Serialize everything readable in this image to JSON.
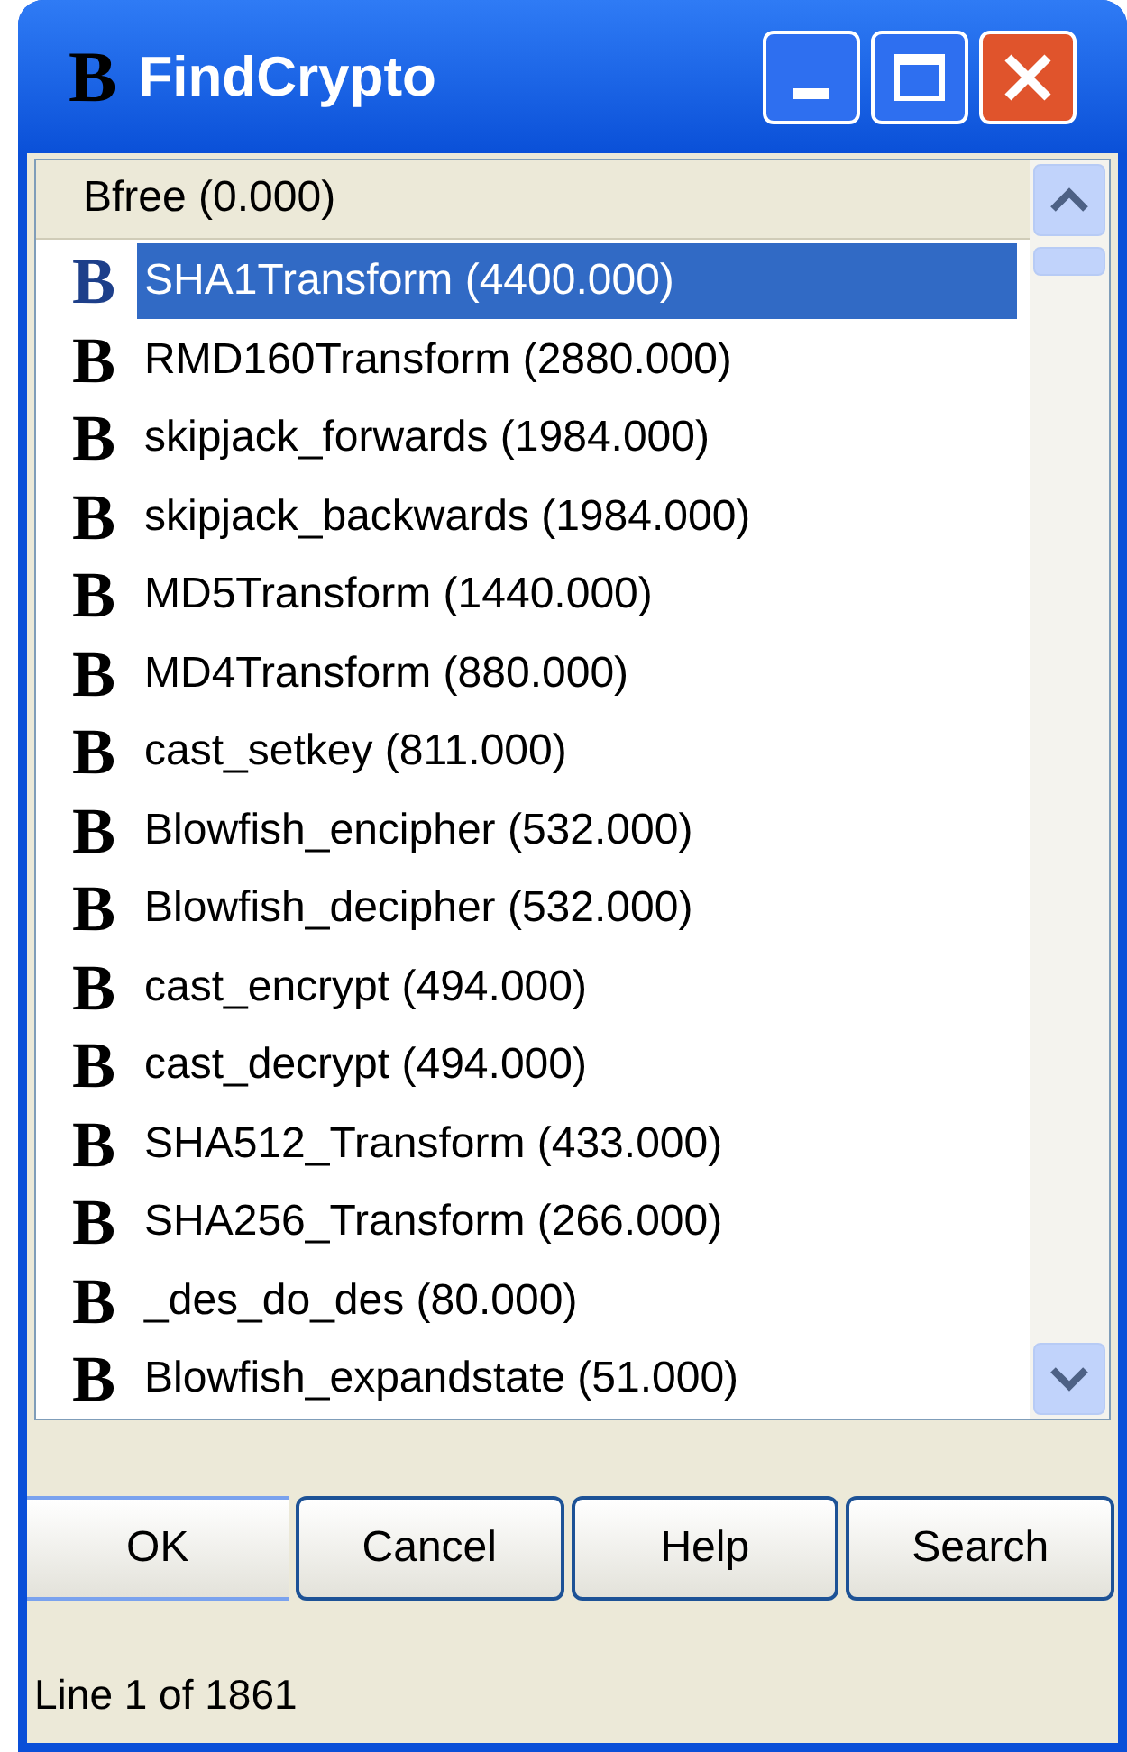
{
  "window": {
    "icon": "B",
    "title": "FindCrypto"
  },
  "list": {
    "header": "Bfree (0.000)",
    "rows": [
      {
        "icon": "B",
        "label": "SHA1Transform (4400.000)",
        "selected": true
      },
      {
        "icon": "B",
        "label": "RMD160Transform (2880.000)",
        "selected": false
      },
      {
        "icon": "B",
        "label": "skipjack_forwards (1984.000)",
        "selected": false
      },
      {
        "icon": "B",
        "label": "skipjack_backwards (1984.000)",
        "selected": false
      },
      {
        "icon": "B",
        "label": "MD5Transform (1440.000)",
        "selected": false
      },
      {
        "icon": "B",
        "label": "MD4Transform (880.000)",
        "selected": false
      },
      {
        "icon": "B",
        "label": "cast_setkey (811.000)",
        "selected": false
      },
      {
        "icon": "B",
        "label": "Blowfish_encipher (532.000)",
        "selected": false
      },
      {
        "icon": "B",
        "label": "Blowfish_decipher (532.000)",
        "selected": false
      },
      {
        "icon": "B",
        "label": "cast_encrypt (494.000)",
        "selected": false
      },
      {
        "icon": "B",
        "label": "cast_decrypt (494.000)",
        "selected": false
      },
      {
        "icon": "B",
        "label": "SHA512_Transform (433.000)",
        "selected": false
      },
      {
        "icon": "B",
        "label": "SHA256_Transform (266.000)",
        "selected": false
      },
      {
        "icon": "B",
        "label": "_des_do_des (80.000)",
        "selected": false
      },
      {
        "icon": "B",
        "label": "Blowfish_expandstate (51.000)",
        "selected": false
      }
    ]
  },
  "buttons": [
    {
      "label": "OK",
      "default": true
    },
    {
      "label": "Cancel",
      "default": false
    },
    {
      "label": "Help",
      "default": false
    },
    {
      "label": "Search",
      "default": false
    }
  ],
  "status_bar": "Line 1 of 1861"
}
